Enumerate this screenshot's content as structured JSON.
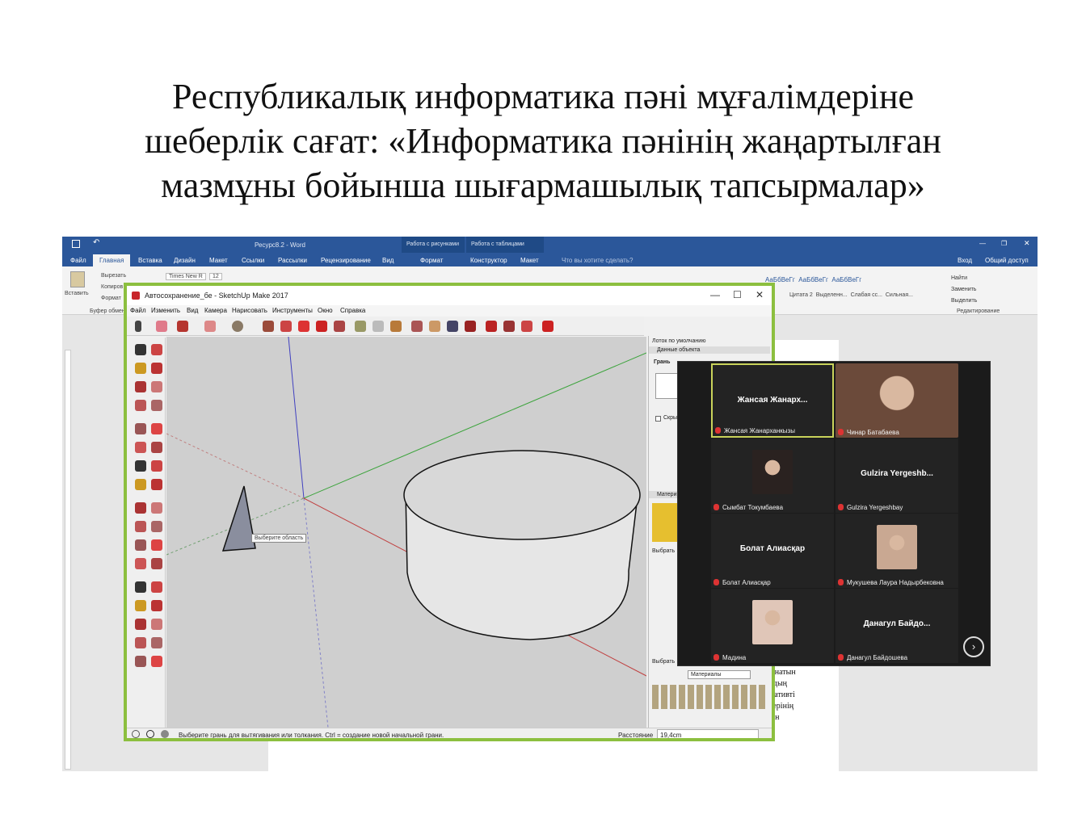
{
  "slide": {
    "title_lines": [
      "Республикалық информатика пәні мұғалімдеріне",
      "шеберлік сағат: «Информатика пәнінің жаңартылған",
      "мазмұны бойынша шығармашылық тапсырмалар»"
    ]
  },
  "word": {
    "title": "Ресурс8.2 - Word",
    "contextual_tabs": [
      "Работа с рисунками",
      "Работа с таблицами"
    ],
    "tabs": [
      "Файл",
      "Главная",
      "Вставка",
      "Дизайн",
      "Макет",
      "Ссылки",
      "Рассылки",
      "Рецензирование",
      "Вид",
      "Формат",
      "Конструктор",
      "Макет"
    ],
    "tell_me": "Что вы хотите сделать?",
    "signin": "Вход",
    "share": "Общий доступ",
    "clipboard": {
      "paste": "Вставить",
      "cut": "Вырезать",
      "copy": "Копиров",
      "format": "Формат",
      "group": "Буфер обмен"
    },
    "font_name": "Times New R",
    "font_size": "12",
    "styles": [
      "АаБбВеГг",
      "АаБбВеГг",
      "АаБбВеГг",
      "АаБбВеГг",
      "АаБбВеГг",
      "AaБбВеГг"
    ],
    "style_names": [
      "Цитата 2",
      "Выделенн...",
      "Слабая сс...",
      "Сильная..."
    ],
    "editing": {
      "find": "Найти",
      "replace": "Заменить",
      "select": "Выделить",
      "group": "Редактирование"
    },
    "doc_text": [
      "ынатын",
      "рдың",
      "мативті",
      "терінің",
      "тін"
    ]
  },
  "sketchup": {
    "title": "Автосохранение_бе - SketchUp Make 2017",
    "menu": [
      "Файл",
      "Изменить",
      "Вид",
      "Камера",
      "Нарисовать",
      "Инструменты",
      "Окно",
      "Справка"
    ],
    "tooltip": "Выберите область",
    "right_panel": {
      "tray": "Лоток по умолчанию",
      "entity_info": "Данные объекта",
      "face": "Грань",
      "hidden": "Скрыт",
      "materials": "Матери",
      "select_label": "Выбрать",
      "select_label2": "Выбрать",
      "materials_dropdown": "Материалы"
    },
    "status_message": "Выберите грань для вытягивания или толкания.  Ctrl = создание новой начальной грани.",
    "distance_label": "Расстояние",
    "distance_value": "19,4cm"
  },
  "zoom": {
    "participants": [
      {
        "display": "Жансая Жанарх...",
        "name": "Жансая Жанарханкызы",
        "highlight": true,
        "photo": false
      },
      {
        "display": "",
        "name": "Чинар Батабаева",
        "highlight": false,
        "photo": true
      },
      {
        "display": "",
        "name": "Сымбат Токумбаева",
        "highlight": false,
        "photo": true
      },
      {
        "display": "Gulzira Yergeshb...",
        "name": "Gulzira Yergeshbay",
        "highlight": false,
        "photo": false
      },
      {
        "display": "Болат Алиасқар",
        "name": "Болат Алиасқар",
        "highlight": false,
        "photo": false
      },
      {
        "display": "",
        "name": "Мукушева Лаура Надырбековна",
        "highlight": false,
        "photo": true
      },
      {
        "display": "",
        "name": "Мадина",
        "highlight": false,
        "photo": true
      },
      {
        "display": "Данагул Байдо...",
        "name": "Данагул Байдошева",
        "highlight": false,
        "photo": false
      }
    ],
    "next_icon": "chevron-right-icon"
  }
}
